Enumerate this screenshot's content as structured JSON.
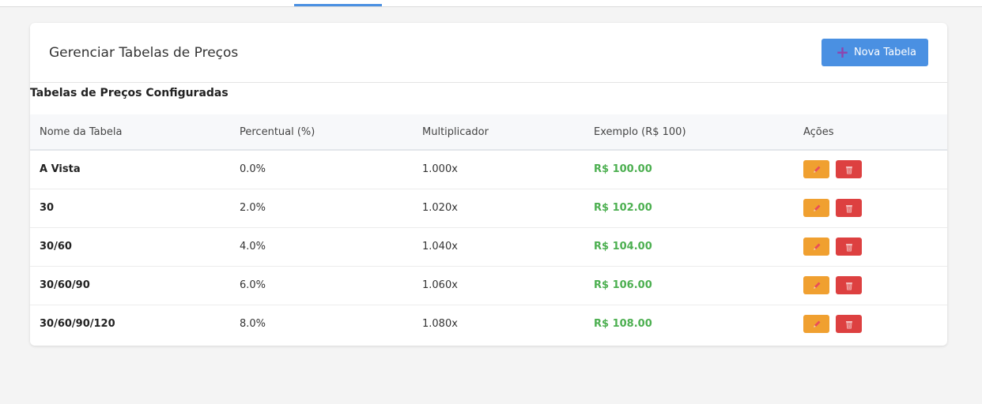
{
  "header": {
    "title": "Gerenciar Tabelas de Preços",
    "new_button_label": "Nova Tabela",
    "new_button_icon": "plus-icon"
  },
  "section": {
    "title": "Tabelas de Preços Configuradas"
  },
  "table": {
    "columns": [
      "Nome da Tabela",
      "Percentual (%)",
      "Multiplicador",
      "Exemplo (R$ 100)",
      "Ações"
    ],
    "rows": [
      {
        "name": "A Vista",
        "percent": "0.0%",
        "multiplier": "1.000x",
        "example": "R$ 100.00"
      },
      {
        "name": "30",
        "percent": "2.0%",
        "multiplier": "1.020x",
        "example": "R$ 102.00"
      },
      {
        "name": "30/60",
        "percent": "4.0%",
        "multiplier": "1.040x",
        "example": "R$ 104.00"
      },
      {
        "name": "30/60/90",
        "percent": "6.0%",
        "multiplier": "1.060x",
        "example": "R$ 106.00"
      },
      {
        "name": "30/60/90/120",
        "percent": "8.0%",
        "multiplier": "1.080x",
        "example": "R$ 108.00"
      }
    ],
    "action_icons": [
      "pencil-icon",
      "trash-icon"
    ]
  },
  "colors": {
    "primary": "#4a90e2",
    "edit": "#f0a030",
    "delete": "#dd4040",
    "example_text": "#4caf50"
  }
}
